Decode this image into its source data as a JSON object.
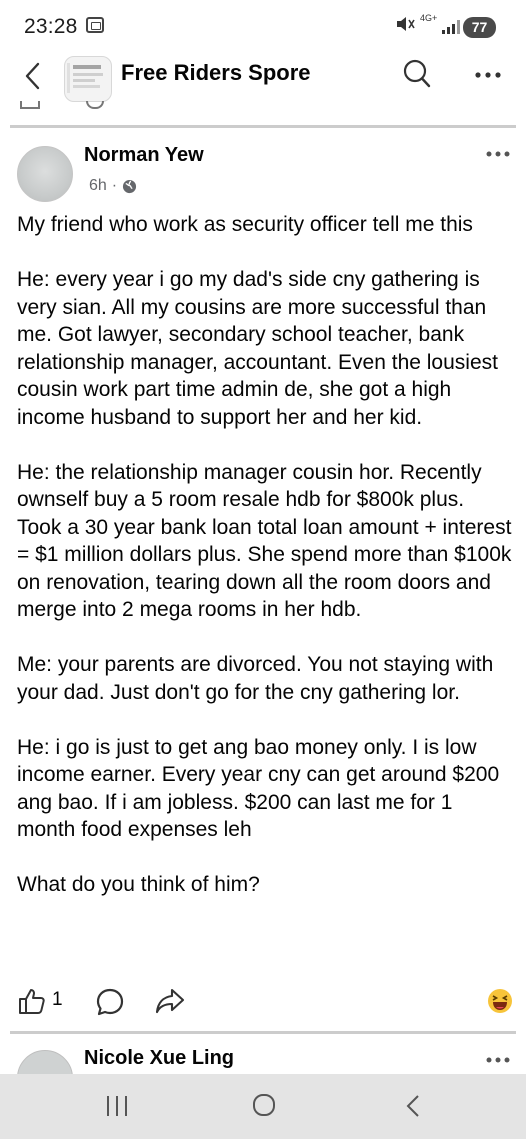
{
  "status_bar": {
    "time": "23:28",
    "network": "4G+",
    "battery": "77"
  },
  "header": {
    "title": "Free Riders Spore"
  },
  "post": {
    "author": "Norman Yew",
    "time": "6h",
    "separator": "·",
    "paragraphs": [
      "My friend who work as security officer tell me this",
      "He: every year i go my dad's side cny gathering is very sian. All my cousins are more successful than me. Got lawyer, secondary school teacher, bank relationship manager, accountant. Even the lousiest cousin work part time admin de, she got a high income husband to support her and her kid.",
      "He: the relationship manager cousin hor. Recently ownself buy a 5 room resale hdb for $800k plus. Took a 30 year bank loan total loan amount + interest = $1 million dollars plus. She spend more than $100k on renovation, tearing down all the room doors and merge into 2 mega rooms in her hdb.",
      "Me: your parents are divorced. You not staying with your dad. Just don't go for the cny gathering lor.",
      "He: i go is just to get ang bao money only. I is low income earner. Every year cny can get around $200 ang bao. If i am jobless. $200 can last me for 1 month food expenses leh",
      "What do you think of him?"
    ],
    "like_count": "1"
  },
  "next_post": {
    "author": "Nicole Xue Ling"
  },
  "icons": {
    "back": "chevron-left-icon",
    "search": "search-icon",
    "more": "more-dots-icon",
    "globe": "globe-icon",
    "like": "thumbs-up-icon",
    "comment": "comment-bubble-icon",
    "share": "share-arrow-icon",
    "emoji": "laughing-emoji-icon"
  },
  "colors": {
    "text": "#050505",
    "meta": "#65676b",
    "divider": "#cccccc",
    "nav_bar": "#e4e4e4"
  }
}
